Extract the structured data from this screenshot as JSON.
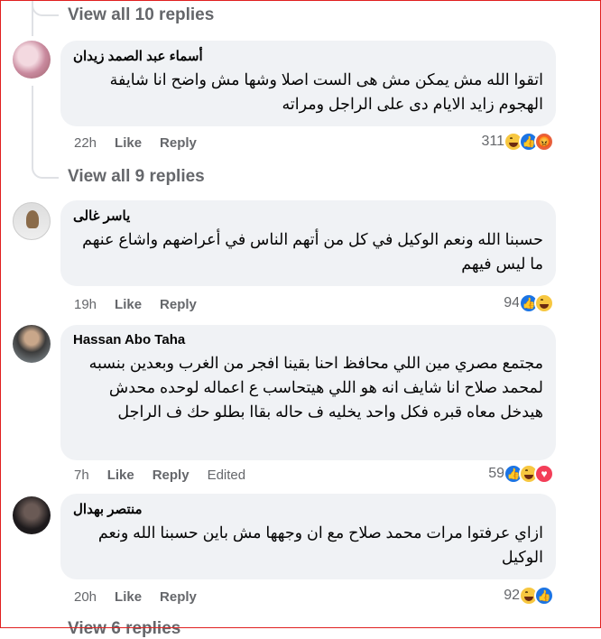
{
  "view_replies_top": "View all 10 replies",
  "view_replies_mid": "View all 9 replies",
  "view_replies_bottom_partial": "View 6 replies",
  "comments": [
    {
      "author": "أسماء عبد الصمد زيدان",
      "text": "اتقوا الله مش يمكن مش هى الست اصلا وشها مش واضح انا شايفة الهجوم زايد الايام دى على الراجل ومراته",
      "time": "22h",
      "like": "Like",
      "reply": "Reply",
      "edited": "",
      "reaction_count": "311",
      "reactions": [
        "haha",
        "like",
        "angry"
      ]
    },
    {
      "author": "ياسر غالى",
      "text": "حسبنا الله ونعم الوكيل في كل من أتهم الناس في أعراضهم واشاع عنهم ما ليس فيهم",
      "time": "19h",
      "like": "Like",
      "reply": "Reply",
      "edited": "",
      "reaction_count": "94",
      "reactions": [
        "like",
        "haha"
      ]
    },
    {
      "author": "Hassan Abo Taha",
      "text": "مجتمع مصري مين اللي محافظ احنا بقينا افجر من الغرب وبعدين بنسبه لمحمد صلاح انا شايف انه هو اللي هيتحاسب ع اعماله لوحده محدش هيدخل معاه قبره فكل واحد يخليه ف حاله بقاا بطلو حك ف الراجل",
      "time": "7h",
      "like": "Like",
      "reply": "Reply",
      "edited": "Edited",
      "reaction_count": "59",
      "reactions": [
        "like",
        "haha",
        "love"
      ]
    },
    {
      "author": "منتصر بهدال",
      "text": "ازاي عرفتوا مرات محمد صلاح مع ان وجهها مش باين حسبنا الله ونعم الوكيل",
      "time": "20h",
      "like": "Like",
      "reply": "Reply",
      "edited": "",
      "reaction_count": "92",
      "reactions": [
        "haha",
        "like"
      ]
    }
  ],
  "colors": {
    "bubble": "#f0f2f5",
    "meta": "#65676b",
    "like_blue": "#1b74e4",
    "haha_yellow": "#f7c740",
    "angry_orange": "#e8603c",
    "love_red": "#f33e58",
    "frame": "#e02020"
  }
}
